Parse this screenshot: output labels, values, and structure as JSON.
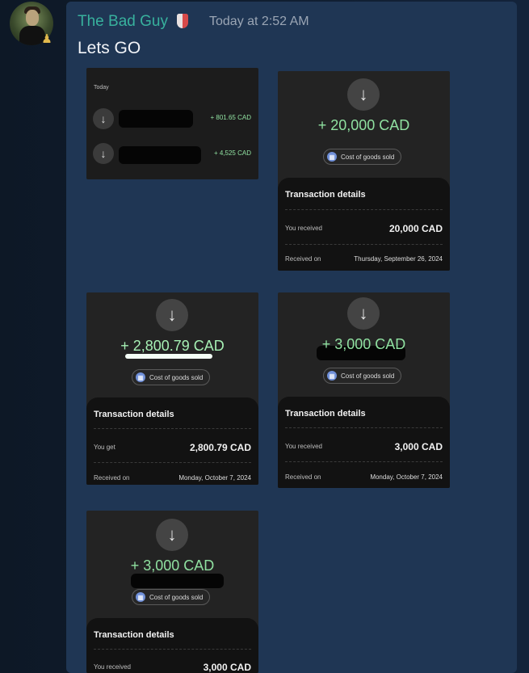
{
  "header": {
    "username": "The Bad Guy",
    "timestamp": "Today at 2:52 AM",
    "message": "Lets GO"
  },
  "icons": {
    "avatar_badge": "pawn-icon",
    "role_badge": "shield-icon",
    "arrow": "arrow-down-icon"
  },
  "colors": {
    "username": "#38b19d",
    "amount_green": "#8fe0a0",
    "panel": "#1f3654"
  },
  "shot1": {
    "section": "Today",
    "rows": [
      {
        "amount": "+ 801.65 CAD"
      },
      {
        "amount": "+ 4,525 CAD"
      }
    ]
  },
  "shot2": {
    "amount": "+ 20,000 CAD",
    "category": "Cost of goods sold",
    "details_title": "Transaction details",
    "label1": "You received",
    "value1": "20,000 CAD",
    "label2": "Received on",
    "value2": "Thursday, September 26, 2024"
  },
  "shot3": {
    "amount": "+ 2,800.79 CAD",
    "category": "Cost of goods sold",
    "details_title": "Transaction details",
    "label1": "You get",
    "value1": "2,800.79 CAD",
    "label2": "Received on",
    "value2": "Monday, October 7, 2024"
  },
  "shot4": {
    "amount": "+ 3,000 CAD",
    "category": "Cost of goods sold",
    "details_title": "Transaction details",
    "label1": "You received",
    "value1": "3,000 CAD",
    "label2": "Received on",
    "value2": "Monday, October 7, 2024"
  },
  "shot5": {
    "amount": "+ 3,000 CAD",
    "category": "Cost of goods sold",
    "details_title": "Transaction details",
    "label1": "You received",
    "value1": "3,000 CAD"
  }
}
